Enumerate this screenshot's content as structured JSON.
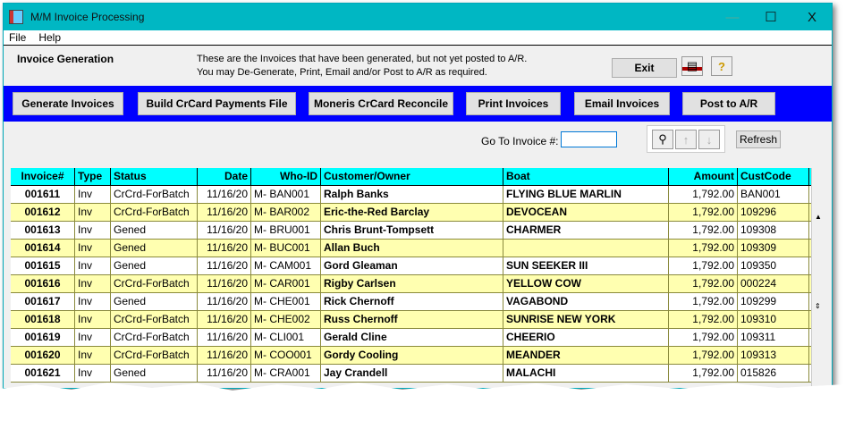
{
  "window": {
    "title": "M/M Invoice Processing",
    "minimize": "—",
    "maximize": "☐",
    "close": "X"
  },
  "menu": [
    "File",
    "Help"
  ],
  "info": {
    "section": "Invoice Generation",
    "line1": "These are the Invoices that have been generated, but not yet posted to A/R.",
    "line2": "You may De-Generate, Print, Email and/or  Post to A/R as required.",
    "exit": "Exit"
  },
  "actions": [
    "Generate Invoices",
    "Build CrCard Payments File",
    "Moneris CrCard Reconcile",
    "Print Invoices",
    "Email Invoices",
    "Post to A/R"
  ],
  "goto": {
    "label": "Go To Invoice #:",
    "value": "",
    "refresh": "Refresh"
  },
  "colors": {
    "titlebar": "#00b7c3",
    "actionbar": "#0000ff",
    "header": "#00ffff",
    "alt_row": "#ffffb0"
  },
  "table": {
    "columns": [
      "Invoice#",
      "Type",
      "Status",
      "Date",
      "Who-ID",
      "Customer/Owner",
      "Boat",
      "Amount",
      "CustCode"
    ],
    "rows": [
      [
        "001611",
        "Inv",
        "CrCrd-ForBatch",
        "11/16/20",
        "M-  BAN001",
        "Ralph Banks",
        "FLYING BLUE MARLIN",
        "1,792.00",
        "BAN001"
      ],
      [
        "001612",
        "Inv",
        "CrCrd-ForBatch",
        "11/16/20",
        "M-  BAR002",
        "Eric-the-Red Barclay",
        "DEVOCEAN",
        "1,792.00",
        "109296"
      ],
      [
        "001613",
        "Inv",
        "Gened",
        "11/16/20",
        "M-  BRU001",
        "Chris Brunt-Tompsett",
        "CHARMER",
        "1,792.00",
        "109308"
      ],
      [
        "001614",
        "Inv",
        "Gened",
        "11/16/20",
        "M-  BUC001",
        "Allan Buch",
        "",
        "1,792.00",
        "109309"
      ],
      [
        "001615",
        "Inv",
        "Gened",
        "11/16/20",
        "M-  CAM001",
        "Gord Gleaman",
        "SUN SEEKER III",
        "1,792.00",
        "109350"
      ],
      [
        "001616",
        "Inv",
        "CrCrd-ForBatch",
        "11/16/20",
        "M-  CAR001",
        "Rigby Carlsen",
        "YELLOW COW",
        "1,792.00",
        "000224"
      ],
      [
        "001617",
        "Inv",
        "Gened",
        "11/16/20",
        "M-  CHE001",
        "Rick Chernoff",
        "VAGABOND",
        "1,792.00",
        "109299"
      ],
      [
        "001618",
        "Inv",
        "CrCrd-ForBatch",
        "11/16/20",
        "M-  CHE002",
        "Russ Chernoff",
        "SUNRISE NEW YORK",
        "1,792.00",
        "109310"
      ],
      [
        "001619",
        "Inv",
        "CrCrd-ForBatch",
        "11/16/20",
        "M-  CLI001",
        "Gerald Cline",
        "CHEERIO",
        "1,792.00",
        "109311"
      ],
      [
        "001620",
        "Inv",
        "CrCrd-ForBatch",
        "11/16/20",
        "M-  COO001",
        "Gordy Cooling",
        "MEANDER",
        "1,792.00",
        "109313"
      ],
      [
        "001621",
        "Inv",
        "Gened",
        "11/16/20",
        "M-  CRA001",
        "Jay Crandell",
        "MALACHI",
        "1,792.00",
        "015826"
      ]
    ]
  }
}
